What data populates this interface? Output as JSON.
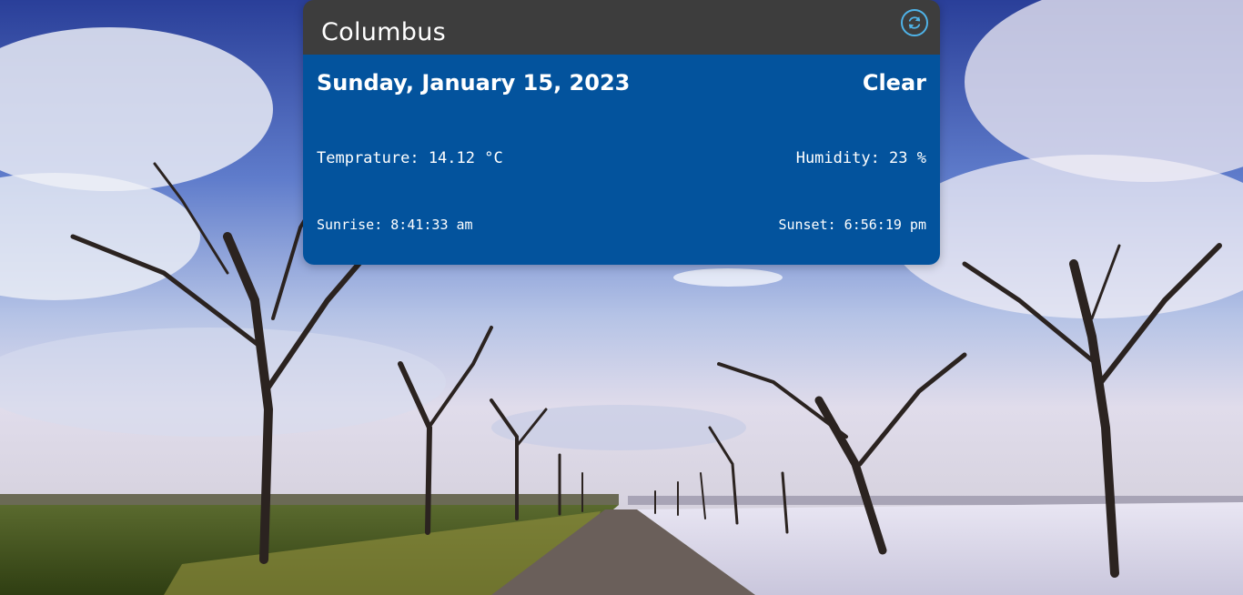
{
  "weather": {
    "city": "Columbus",
    "date": "Sunday, January 15, 2023",
    "condition": "Clear",
    "temperature": "Temprature: 14.12 °C",
    "humidity": "Humidity: 23 %",
    "sunrise": "Sunrise: 8:41:33 am",
    "sunset": "Sunset: 6:56:19 pm"
  },
  "icons": {
    "refresh": "refresh-icon"
  },
  "colors": {
    "header_bg": "#3d3d3d",
    "body_bg": "#03539d",
    "refresh_accent": "#4fb3e8",
    "text": "#ffffff"
  }
}
